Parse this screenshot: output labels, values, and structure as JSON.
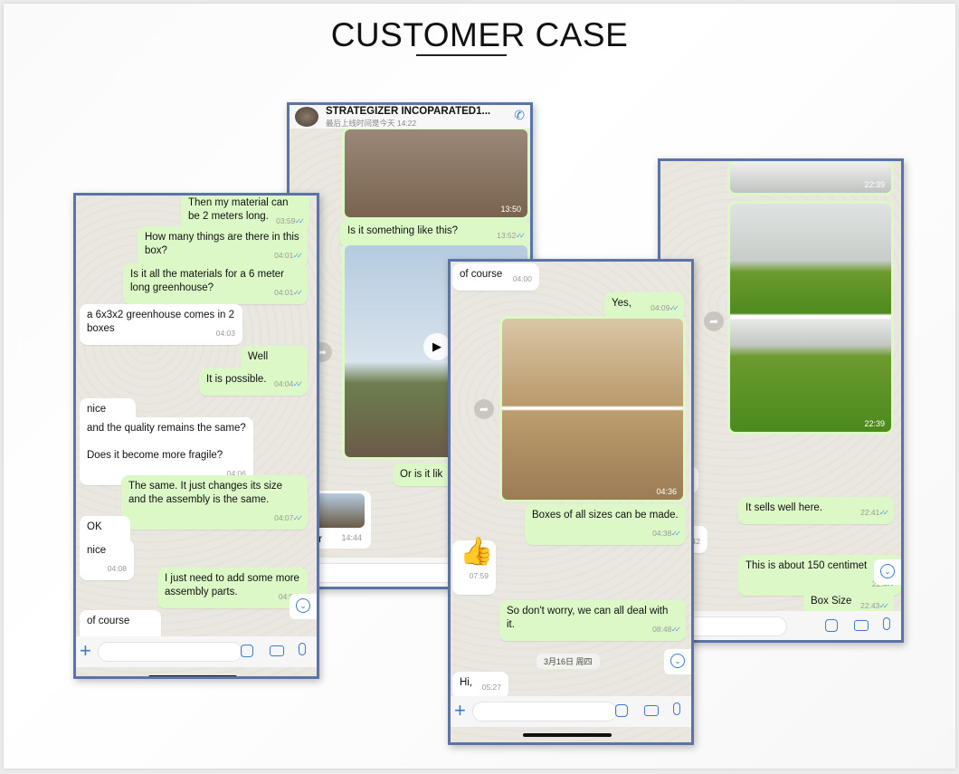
{
  "title": "CUSTOMER CASE",
  "phones": [
    {
      "messages": [
        {
          "dir": "out",
          "text": "Then my material can be 2 meters long.",
          "time": "03:59"
        },
        {
          "dir": "out",
          "text": "How many things are there in this box?",
          "time": "04:01"
        },
        {
          "dir": "out",
          "text": "Is it all the materials for a 6 meter long greenhouse?",
          "time": "04:01"
        },
        {
          "dir": "in",
          "text": "a 6x3x2 greenhouse comes in 2 boxes",
          "time": "04:03"
        },
        {
          "dir": "out",
          "text": "Well",
          "time": "04:04"
        },
        {
          "dir": "out",
          "text": "It is possible.",
          "time": "04:04"
        },
        {
          "dir": "in",
          "text": "nice",
          "time": "04:05"
        },
        {
          "dir": "in",
          "text": "and the quality remains the same?\n\nDoes it become more fragile?",
          "time": "04:06"
        },
        {
          "dir": "out",
          "text": "The same. It just changes its size and the assembly is the same.",
          "time": "04:07"
        },
        {
          "dir": "in",
          "text": "OK",
          "time": "04:08"
        },
        {
          "dir": "in",
          "text": "nice",
          "time": "04:08"
        },
        {
          "dir": "out",
          "text": "I just need to add some more assembly parts.",
          "time": "04:0"
        },
        {
          "dir": "in",
          "text": "of course",
          "time": "04:09"
        }
      ]
    },
    {
      "header": {
        "name": "STRATEGIZER INCOPARATED1...",
        "status": "最后上线时间是今天 14:22"
      },
      "messages": [
        {
          "dir": "out",
          "type": "image",
          "time": "13:50"
        },
        {
          "dir": "out",
          "text": "Is it something like this?",
          "time": "13:52"
        },
        {
          "dir": "out",
          "type": "video"
        },
        {
          "dir": "out",
          "text": "Or is it lik"
        },
        {
          "dir": "in",
          "type": "image",
          "text": "sir",
          "time": "14:44"
        }
      ]
    },
    {
      "messages": [
        {
          "dir": "in",
          "text": "of course",
          "time": "04:00"
        },
        {
          "dir": "out",
          "text": "Yes,",
          "time": "04:09"
        },
        {
          "dir": "out",
          "type": "image",
          "time": "04:36"
        },
        {
          "dir": "out",
          "text": "Boxes of all sizes can be made.",
          "time": "04:38"
        },
        {
          "dir": "in",
          "text": "👍",
          "time": "07:59"
        },
        {
          "dir": "out",
          "text": "So don't worry, we can all deal with it.",
          "time": "08:48"
        },
        {
          "dir": "date",
          "text": "3月16日 周四"
        },
        {
          "dir": "in",
          "text": "Hi,",
          "time": "05:27"
        }
      ]
    },
    {
      "messages": [
        {
          "dir": "out",
          "type": "image",
          "time": "22:39"
        },
        {
          "dir": "out",
          "type": "image",
          "time": "22:39"
        },
        {
          "dir": "in",
          "text": "",
          "time": "22:40"
        },
        {
          "dir": "in",
          "text": "s it",
          "time": "22:40"
        },
        {
          "dir": "out",
          "text": "It sells well here.",
          "time": "22:41"
        },
        {
          "dir": "in",
          "text": "ere",
          "time": "22:42"
        },
        {
          "dir": "out",
          "text": "This is about 150 centimet",
          "time": "22:4"
        },
        {
          "dir": "out",
          "text": "Box Size",
          "time": "22:43"
        }
      ]
    }
  ],
  "colors": {
    "frame": "#5a74a6",
    "outgoing": "#dcf8c6",
    "incoming": "#ffffff",
    "accent": "#3a7bd5"
  }
}
